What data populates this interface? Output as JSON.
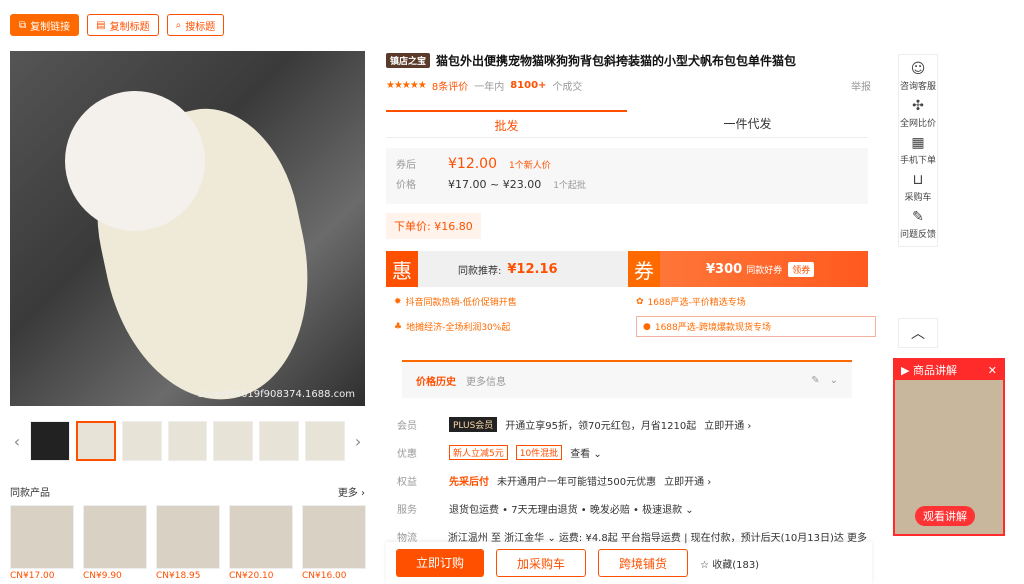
{
  "toolbar": {
    "copy_link": "复制链接",
    "copy_title": "复制标题",
    "search_title": "搜标题"
  },
  "gallery": {
    "watermark": "shop698619f908374.1688.com"
  },
  "similar": {
    "heading": "同款产品",
    "more": "更多 ›",
    "items": [
      {
        "price": "CN¥17.00"
      },
      {
        "price": "CN¥9.90"
      },
      {
        "price": "CN¥18.95"
      },
      {
        "price": "CN¥20.10"
      },
      {
        "price": "CN¥16.00"
      }
    ]
  },
  "product": {
    "store_badge": "镇店之宝",
    "title": "猫包外出便携宠物猫咪狗狗背包斜挎装猫的小型犬帆布包包单件猫包",
    "stars": "★★★★★",
    "reviews": "8条评价",
    "sales_prefix": "一年内",
    "sales_count": "8100+",
    "sales_suffix": "个成交",
    "report": "举报"
  },
  "tabs": {
    "wholesale": "批发",
    "dropship": "一件代发"
  },
  "pricing": {
    "coupon_label": "券后",
    "coupon_price": "¥12.00",
    "coupon_note": "1个新人价",
    "price_label": "价格",
    "price_range": "¥17.00 ~ ¥23.00",
    "price_note": "1个起批",
    "order_price": "下单价: ¥16.80"
  },
  "promo": {
    "hui": "惠",
    "same_label": "同款推荐:",
    "same_price": "¥12.16",
    "quan": "券",
    "coupon_value": "¥300",
    "coupon_text": "同款好券",
    "claim": "领券"
  },
  "promo_list": [
    "抖音同款热销-低价促销开售",
    "1688严选-平价精选专场",
    "地摊经济-全场利润30%起",
    "1688严选-跨境爆款现货专场"
  ],
  "history": {
    "title": "价格历史",
    "more": "更多信息"
  },
  "info": {
    "member_k": "会员",
    "plus": "PLUS会员",
    "member_text": "开通立享95折，领70元红包，月省1210起",
    "member_link": "立即开通 ›",
    "discount_k": "优惠",
    "tag1": "新人立减5元",
    "tag2": "10件混批",
    "discount_view": "查看 ⌄",
    "rights_k": "权益",
    "rights_bold": "先采后付",
    "rights_text": "未开通用户一年可能错过500元优惠",
    "rights_link": "立即开通 ›",
    "service_k": "服务",
    "service_text": "退货包运费 • 7天无理由退货 • 晚发必赔 • 极速退款 ⌄",
    "logistics_k": "物流",
    "logistics_text": "浙江温州 至 浙江金华 ⌄ 运费: ¥4.8起 平台指导运费 | 现在付款，预计后天(10月13日)达 更多 ⌄"
  },
  "actions": {
    "buy": "立即订购",
    "cart": "加采购车",
    "crossborder": "跨境铺货",
    "fav": "☆ 收藏(183)"
  },
  "sidebar": [
    "咨询客服",
    "全网比价",
    "手机下单",
    "采购车",
    "问题反馈"
  ],
  "live": {
    "title": "▶ 商品讲解",
    "watch": "观看讲解"
  }
}
